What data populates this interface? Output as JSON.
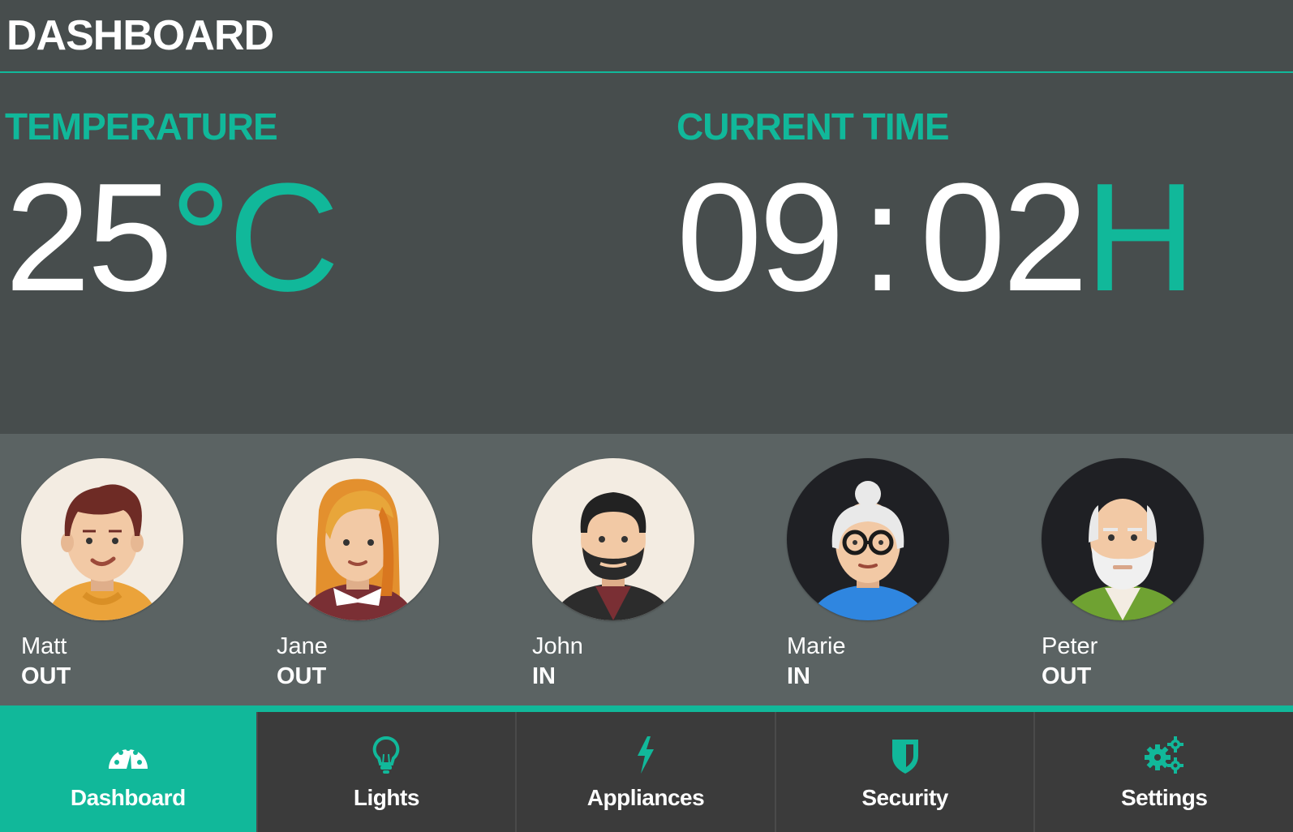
{
  "header": {
    "title": "DASHBOARD"
  },
  "temperature": {
    "label": "TEMPERATURE",
    "value": "25",
    "unit": "°C"
  },
  "current_time": {
    "label": "CURRENT TIME",
    "hours": "09",
    "separator": ":",
    "minutes": "02",
    "suffix": "H"
  },
  "people": [
    {
      "name": "Matt",
      "status": "OUT",
      "avatar": "man-brown-hair-avatar"
    },
    {
      "name": "Jane",
      "status": "OUT",
      "avatar": "woman-blonde-avatar"
    },
    {
      "name": "John",
      "status": "IN",
      "avatar": "man-beard-avatar"
    },
    {
      "name": "Marie",
      "status": "IN",
      "avatar": "grandma-glasses-avatar"
    },
    {
      "name": "Peter",
      "status": "OUT",
      "avatar": "grandpa-beard-avatar"
    }
  ],
  "nav": {
    "active": "Dashboard",
    "items": [
      {
        "label": "Dashboard",
        "icon": "speedometer-icon"
      },
      {
        "label": "Lights",
        "icon": "lightbulb-icon"
      },
      {
        "label": "Appliances",
        "icon": "lightning-bolt-icon"
      },
      {
        "label": "Security",
        "icon": "shield-icon"
      },
      {
        "label": "Settings",
        "icon": "gears-icon"
      }
    ]
  },
  "colors": {
    "accent": "#11b89a",
    "background": "#474d4d",
    "people_band": "#5b6363",
    "nav_background": "#3b3b3b"
  }
}
